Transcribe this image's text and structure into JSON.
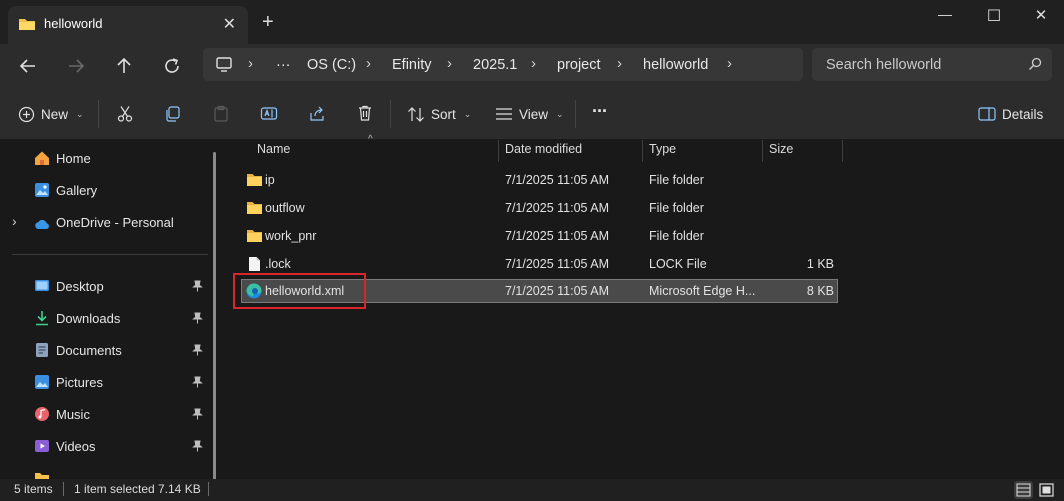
{
  "window": {
    "tab_title": "helloworld",
    "tab_close": "✕",
    "new_tab": "+",
    "minimize": "—",
    "maximize": "☐",
    "close": "✕"
  },
  "breadcrumb": {
    "overflow": "···",
    "items": [
      "OS (C:)",
      "Efinity",
      "2025.1",
      "project",
      "helloworld"
    ]
  },
  "search": {
    "placeholder": "Search helloworld"
  },
  "toolbar": {
    "new_label": "New",
    "sort_label": "Sort",
    "view_label": "View",
    "more_label": "···",
    "details_label": "Details"
  },
  "sidebar": {
    "top": [
      {
        "label": "Home",
        "icon": "home-icon"
      },
      {
        "label": "Gallery",
        "icon": "gallery-icon"
      },
      {
        "label": "OneDrive - Personal",
        "icon": "onedrive-icon"
      }
    ],
    "quick": [
      {
        "label": "Desktop",
        "icon": "desktop-icon"
      },
      {
        "label": "Downloads",
        "icon": "downloads-icon"
      },
      {
        "label": "Documents",
        "icon": "documents-icon"
      },
      {
        "label": "Pictures",
        "icon": "pictures-icon"
      },
      {
        "label": "Music",
        "icon": "music-icon"
      },
      {
        "label": "Videos",
        "icon": "videos-icon"
      }
    ]
  },
  "columns": {
    "name": "Name",
    "date": "Date modified",
    "type": "Type",
    "size": "Size"
  },
  "files": [
    {
      "name": "ip",
      "date": "7/1/2025 11:05 AM",
      "type": "File folder",
      "size": "",
      "icon": "folder-icon"
    },
    {
      "name": "outflow",
      "date": "7/1/2025 11:05 AM",
      "type": "File folder",
      "size": "",
      "icon": "folder-icon"
    },
    {
      "name": "work_pnr",
      "date": "7/1/2025 11:05 AM",
      "type": "File folder",
      "size": "",
      "icon": "folder-icon"
    },
    {
      "name": ".lock",
      "date": "7/1/2025 11:05 AM",
      "type": "LOCK File",
      "size": "1 KB",
      "icon": "file-icon"
    },
    {
      "name": "helloworld.xml",
      "date": "7/1/2025 11:05 AM",
      "type": "Microsoft Edge H...",
      "size": "8 KB",
      "icon": "edge-icon"
    }
  ],
  "status": {
    "count": "5 items",
    "selected": "1 item selected",
    "size": "7.14 KB"
  },
  "colors": {
    "accent_red": "#d9262b",
    "folder_yellow": "#f3c14b"
  }
}
